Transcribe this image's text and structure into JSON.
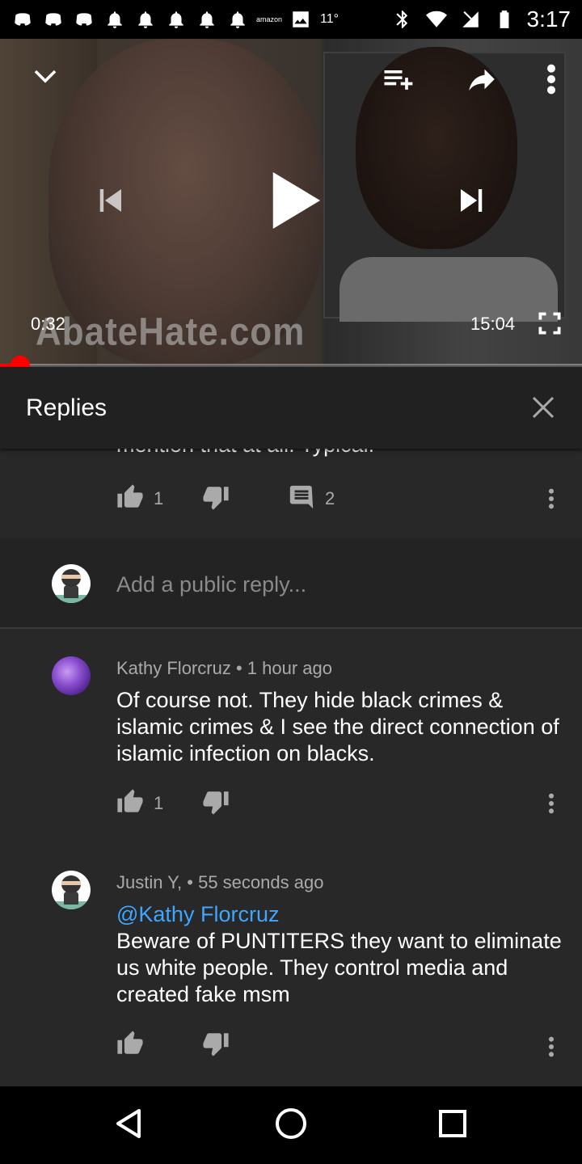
{
  "status_bar": {
    "notification_icons": [
      "discord-icon",
      "discord-icon",
      "discord-icon",
      "bell-icon",
      "bell-icon",
      "bell-icon",
      "bell-icon",
      "bell-icon",
      "amazon-icon",
      "image-icon"
    ],
    "amazon_label": "amazon",
    "temperature": "11°",
    "time": "3:17"
  },
  "player": {
    "watermark": "AbateHate.com",
    "current_time": "0:32",
    "total_time": "15:04",
    "progress_fraction": 0.035,
    "accent_color": "#ff0000"
  },
  "replies_panel": {
    "title": "Replies"
  },
  "parent_comment": {
    "clipped_text": "mention that at all. Typical.",
    "likes": "1",
    "replies_count": "2"
  },
  "reply_box": {
    "placeholder": "Add a public reply..."
  },
  "comments": [
    {
      "author": "Kathy Florcruz",
      "separator": "•",
      "time": "1 hour ago",
      "mention": "",
      "text": "Of course not. They hide black crimes & islamic crimes & I see the direct connection of islamic infection on blacks.",
      "likes": "1"
    },
    {
      "author": "Justin Y,",
      "separator": "•",
      "time": "55 seconds ago",
      "mention": "@Kathy Florcruz",
      "text": "Beware of PUNTITERS they want to eliminate us white people. They control media and created fake msm",
      "likes": ""
    }
  ],
  "mention_color": "#3ea6ff"
}
